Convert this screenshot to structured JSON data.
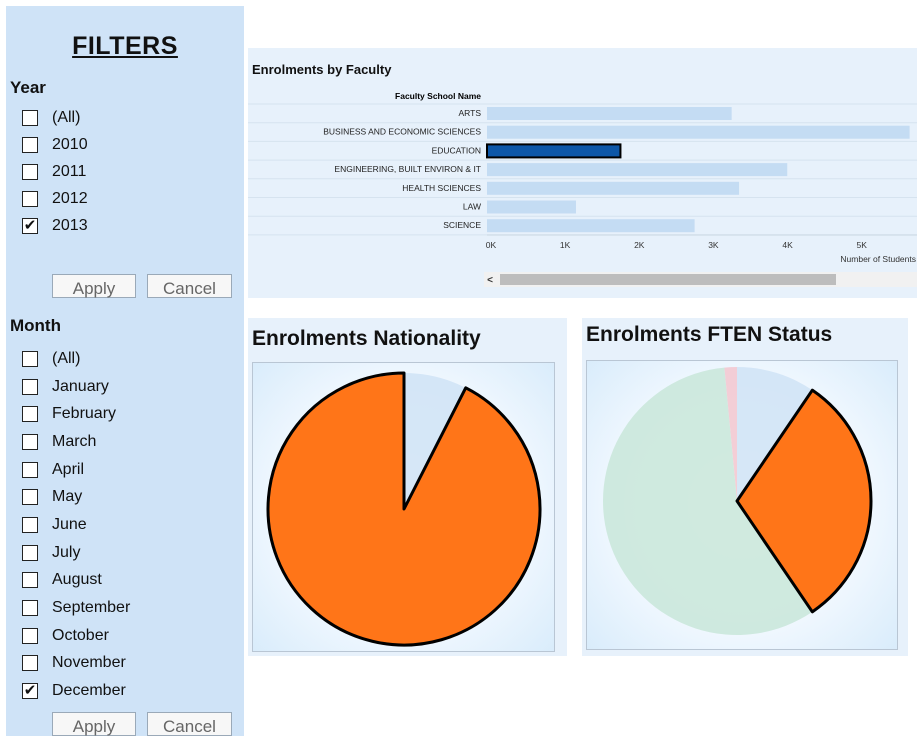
{
  "filters": {
    "title": "FILTERS",
    "year": {
      "label": "Year",
      "options": [
        {
          "label": "(All)",
          "checked": false
        },
        {
          "label": "2010",
          "checked": false
        },
        {
          "label": "2011",
          "checked": false
        },
        {
          "label": "2012",
          "checked": false
        },
        {
          "label": "2013",
          "checked": true
        }
      ],
      "apply_label": "Apply",
      "cancel_label": "Cancel"
    },
    "month": {
      "label": "Month",
      "options": [
        {
          "label": "(All)",
          "checked": false
        },
        {
          "label": "January",
          "checked": false
        },
        {
          "label": "February",
          "checked": false
        },
        {
          "label": "March",
          "checked": false
        },
        {
          "label": "April",
          "checked": false
        },
        {
          "label": "May",
          "checked": false
        },
        {
          "label": "June",
          "checked": false
        },
        {
          "label": "July",
          "checked": false
        },
        {
          "label": "August",
          "checked": false
        },
        {
          "label": "September",
          "checked": false
        },
        {
          "label": "October",
          "checked": false
        },
        {
          "label": "November",
          "checked": false
        },
        {
          "label": "December",
          "checked": true
        }
      ],
      "apply_label": "Apply",
      "cancel_label": "Cancel"
    },
    "check_glyph": "✔"
  },
  "colors": {
    "panel_bg": "#cfe3f7",
    "bar": "#c4dcf3",
    "bar_selected": "#0d57a8",
    "slice_orange": "#ff7518",
    "slice_light_blue": "#cfe3f6",
    "slice_green": "#c8e6d9",
    "slice_pink": "#f2c6cf"
  },
  "chart_data": [
    {
      "type": "bar",
      "orientation": "horizontal",
      "title": "Enrolments by Faculty",
      "category_header": "Faculty School Name",
      "categories": [
        "ARTS",
        "BUSINESS AND ECONOMIC SCIENCES",
        "EDUCATION",
        "ENGINEERING, BUILT ENVIRON & IT",
        "HEALTH SCIENCES",
        "LAW",
        "SCIENCE"
      ],
      "values": [
        3300,
        5700,
        1800,
        4050,
        3400,
        1200,
        2800
      ],
      "selected_index": 2,
      "xlabel": "Number of Students",
      "xticks": [
        "0K",
        "1K",
        "2K",
        "3K",
        "4K",
        "5K"
      ],
      "xlim": [
        0,
        5700
      ],
      "scrollbar_arrow": "<"
    },
    {
      "type": "pie",
      "title": "Enrolments Nationality",
      "slices": [
        {
          "value": 7.5,
          "color": "#cfe3f6",
          "highlighted": false
        },
        {
          "value": 92.5,
          "color": "#ff7518",
          "highlighted": true
        }
      ]
    },
    {
      "type": "pie",
      "title": "Enrolments FTEN Status",
      "slices": [
        {
          "value": 9.5,
          "color": "#cfe3f6",
          "highlighted": false
        },
        {
          "value": 31,
          "color": "#ff7518",
          "highlighted": true
        },
        {
          "value": 58,
          "color": "#c8e6d9",
          "highlighted": false
        },
        {
          "value": 1.5,
          "color": "#f2c6cf",
          "highlighted": false
        }
      ]
    }
  ]
}
